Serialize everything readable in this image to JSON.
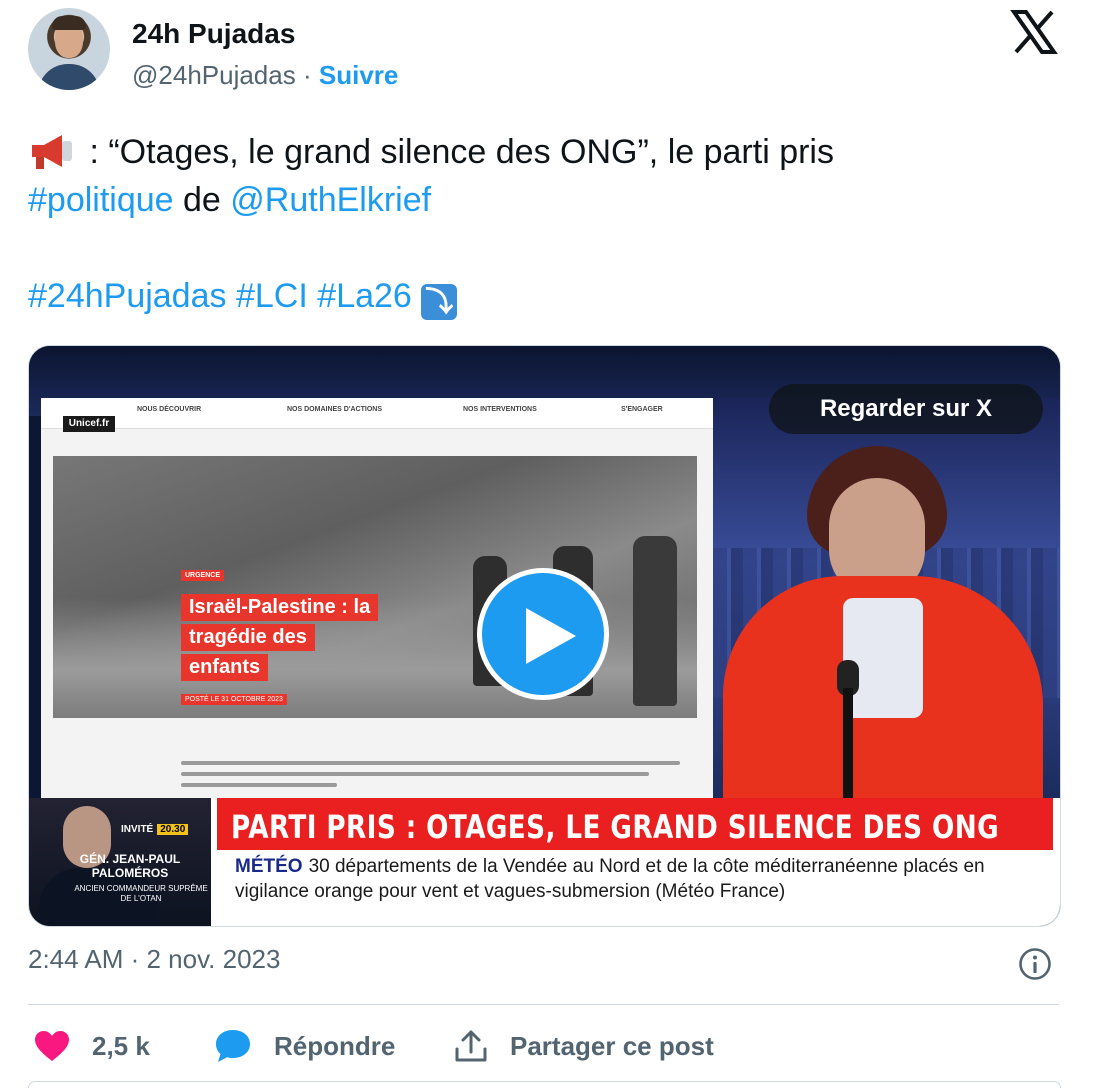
{
  "author": {
    "name": "24h Pujadas",
    "handle": "@24hPujadas",
    "separator": "·",
    "follow_label": "Suivre"
  },
  "tweet": {
    "megaphone_icon": "megaphone-emoji",
    "text_part1": " : “Otages, le grand silence des ONG”, le parti pris ",
    "hashtag_politique": "#politique",
    "text_de": " de ",
    "mention": "@RuthElkrief",
    "hashtags": [
      "#24hPujadas",
      "#LCI",
      "#La26"
    ],
    "arrow_emoji": "⤵"
  },
  "media": {
    "watch_label": "Regarder sur X",
    "website": {
      "logo": "Unicef.fr",
      "nav": [
        "NOUS DÉCOUVRIR",
        "NOS DOMAINES D'ACTIONS",
        "NOS INTERVENTIONS",
        "S'ENGAGER"
      ],
      "tag": "URGENCE",
      "headline": [
        "Israël-Palestine : la",
        "tragédie des",
        "enfants"
      ],
      "posted": "POSTÉ LE 31 OCTOBRE 2023"
    },
    "guest": {
      "invite": "INVITÉ",
      "time": "20.30",
      "name": "GÉN. JEAN-PAUL PALOMÉROS",
      "role": "ANCIEN COMMANDEUR SUPRÊME DE L'OTAN"
    },
    "banner": "PARTI PRIS : OTAGES, LE GRAND SILENCE DES ONG",
    "ticker_label": "MÉTÉO",
    "ticker_text": "30 départements de la Vendée au Nord et de la côte méditerranéenne placés en vigilance orange pour vent et vagues-submersion (Météo France)"
  },
  "meta": {
    "timestamp": "2:44 AM · 2 nov. 2023"
  },
  "actions": {
    "likes": "2,5 k",
    "reply": "Répondre",
    "share": "Partager ce post"
  },
  "colors": {
    "accent": "#1d9bf0",
    "like": "#f91880",
    "text": "#0f1419",
    "secondary": "#536471"
  }
}
